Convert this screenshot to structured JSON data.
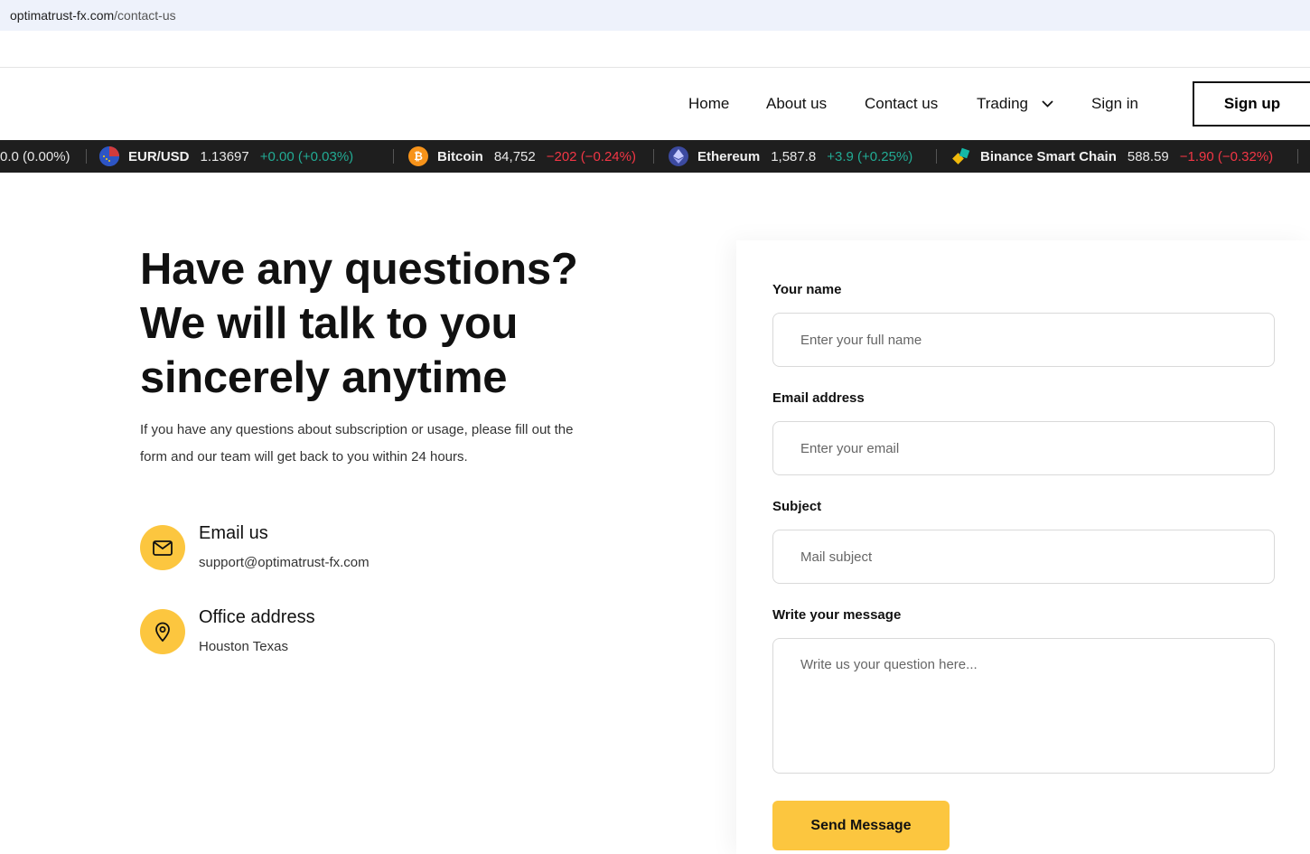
{
  "browser": {
    "url_domain": "optimatrust-fx.com",
    "url_path": "/contact-us"
  },
  "nav": {
    "items": [
      {
        "label": "Home"
      },
      {
        "label": "About us"
      },
      {
        "label": "Contact us"
      },
      {
        "label": "Trading"
      },
      {
        "label": "Sign in"
      }
    ],
    "signup_label": "Sign up"
  },
  "ticker": [
    {
      "name": "",
      "price": "",
      "change": "0.0 (0.00%)",
      "direction": "neutral",
      "icon": ""
    },
    {
      "name": "EUR/USD",
      "price": "1.13697",
      "change": "+0.00 (+0.03%)",
      "direction": "up",
      "icon": "flag-eu-us-icon"
    },
    {
      "name": "Bitcoin",
      "price": "84,752",
      "change": "−202 (−0.24%)",
      "direction": "down",
      "icon": "bitcoin-icon"
    },
    {
      "name": "Ethereum",
      "price": "1,587.8",
      "change": "+3.9 (+0.25%)",
      "direction": "up",
      "icon": "ethereum-icon"
    },
    {
      "name": "Binance Smart Chain",
      "price": "588.59",
      "change": "−1.90 (−0.32%)",
      "direction": "down",
      "icon": "bnb-icon"
    }
  ],
  "hero": {
    "line1": "Have any questions?",
    "line2": "We will talk to you",
    "line3": "sincerely anytime",
    "description": "If you have any questions about subscription or usage, please fill out the form and our team will get back to you within 24 hours."
  },
  "contact": {
    "email_title": "Email us",
    "email_value": "support@optimatrust-fx.com",
    "office_title": "Office address",
    "office_value": "Houston Texas"
  },
  "form": {
    "name_label": "Your name",
    "name_placeholder": "Enter your full name",
    "email_label": "Email address",
    "email_placeholder": "Enter your email",
    "subject_label": "Subject",
    "subject_placeholder": "Mail subject",
    "message_label": "Write your message",
    "message_placeholder": "Write us your question here...",
    "submit_label": "Send Message"
  },
  "colors": {
    "accent": "#fcc63f",
    "ticker_bg": "#1e1e1e",
    "up": "#22ab94",
    "down": "#f23645"
  }
}
